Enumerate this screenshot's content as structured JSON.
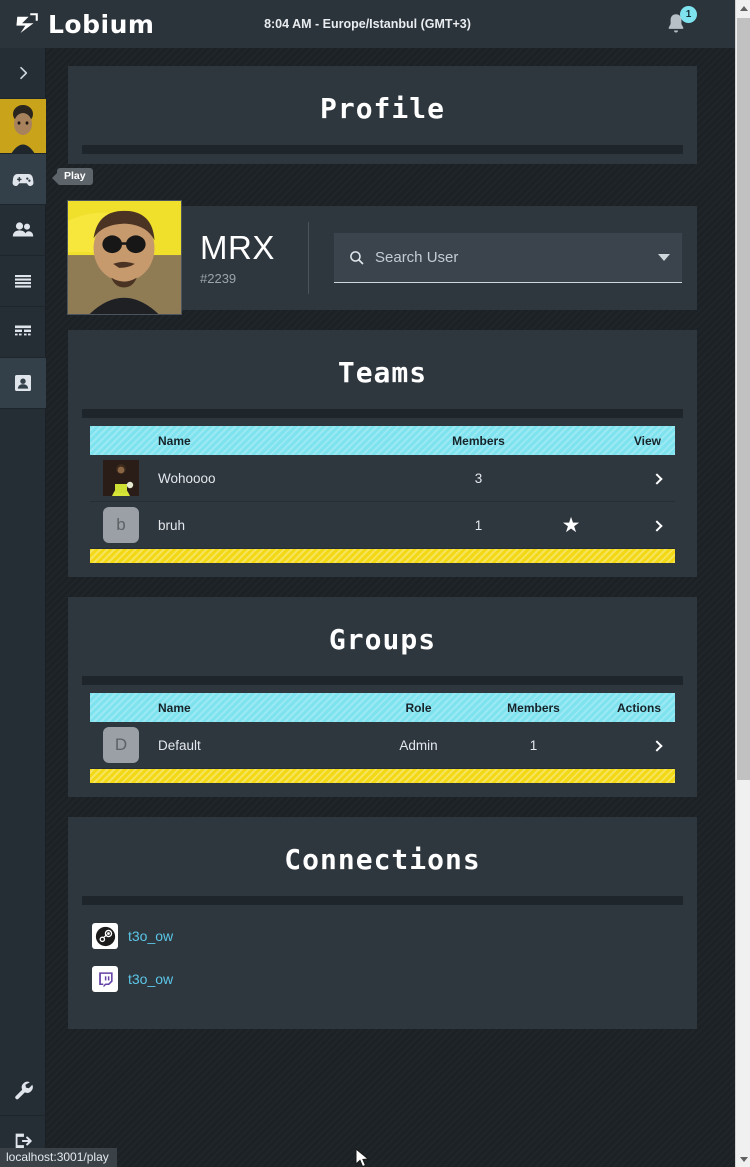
{
  "topbar": {
    "brand": "Lobium",
    "brand_icon": "lobium-logo-icon",
    "clock": "8:04 AM - Europe/Istanbul (GMT+3)",
    "bell_icon": "bell-icon",
    "notification_count": "1"
  },
  "rail": {
    "expand_icon": "chevron-right-icon",
    "avatar_icon": "user-avatar-image",
    "items": [
      {
        "icon": "gamepad-icon",
        "name": "play",
        "active": true
      },
      {
        "icon": "users-icon",
        "name": "friends",
        "active": false
      },
      {
        "icon": "list-lines-icon",
        "name": "lobbies",
        "active": false
      },
      {
        "icon": "keyboard-icon",
        "name": "tournaments",
        "active": false
      },
      {
        "icon": "profile-card-icon",
        "name": "profile",
        "active": true
      }
    ],
    "bottom_items": [
      {
        "icon": "wrench-icon",
        "name": "settings"
      },
      {
        "icon": "logout-icon",
        "name": "logout"
      }
    ]
  },
  "tooltip": {
    "label": "Play"
  },
  "profile": {
    "section_title": "Profile",
    "avatar_icon": "profile-photo",
    "username": "MRX",
    "tag": "#2239",
    "search": {
      "placeholder": "Search User",
      "value": "",
      "icon": "search-icon",
      "dropdown_icon": "chevron-down-icon"
    }
  },
  "teams": {
    "section_title": "Teams",
    "columns": [
      "",
      "Name",
      "Members",
      "",
      "View"
    ],
    "rows": [
      {
        "avatar": "team-avatar-image",
        "name": "Wohoooo",
        "members": "3",
        "favorite": false,
        "view_icon": "chevron-right-icon"
      },
      {
        "avatar": "b",
        "name": "bruh",
        "members": "1",
        "favorite": true,
        "view_icon": "chevron-right-icon"
      }
    ]
  },
  "groups": {
    "section_title": "Groups",
    "columns": [
      "",
      "Name",
      "Role",
      "Members",
      "Actions"
    ],
    "rows": [
      {
        "avatar": "D",
        "name": "Default",
        "role": "Admin",
        "members": "1",
        "view_icon": "chevron-right-icon"
      }
    ]
  },
  "connections": {
    "section_title": "Connections",
    "items": [
      {
        "platform_icon": "steam-icon",
        "username": "t3o_ow"
      },
      {
        "platform_icon": "twitch-icon",
        "username": "t3o_ow"
      }
    ]
  },
  "statusbar": {
    "url": "localhost:3001/play"
  },
  "colors": {
    "accent_cyan": "#7fe3ef",
    "accent_yellow": "#f3d915",
    "link_blue": "#5bc7e8",
    "card_bg": "#2e363e",
    "page_bg": "#1b2125",
    "rail_bg": "#262e35",
    "topbar_bg": "#2b333b"
  }
}
